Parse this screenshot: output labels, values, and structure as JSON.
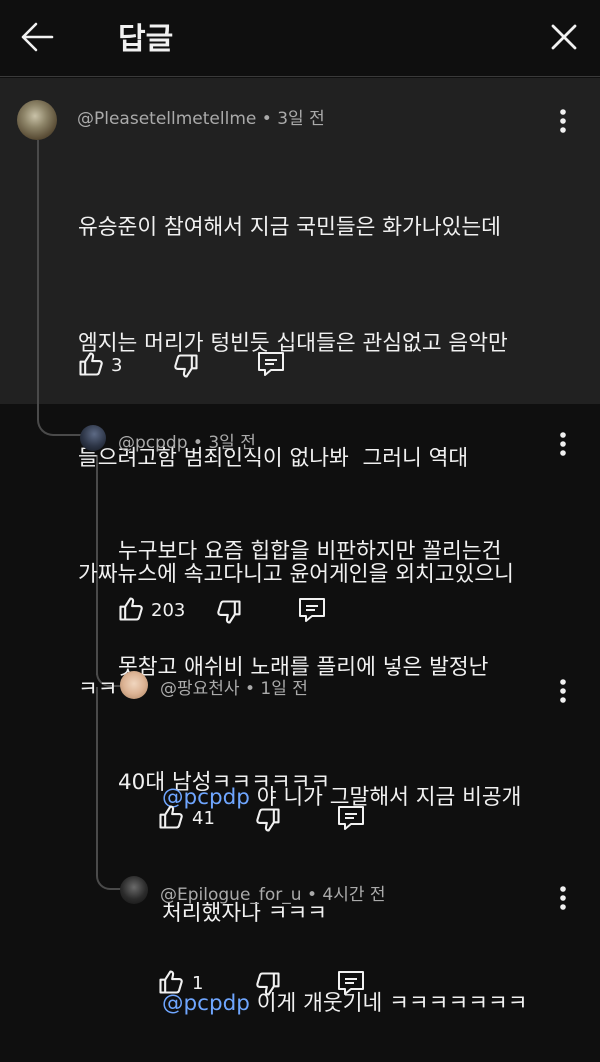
{
  "header": {
    "title": "답글",
    "back_icon": "arrow-left-icon",
    "close_icon": "close-icon"
  },
  "comments": [
    {
      "author": "@Pleasetellmetellme",
      "time": "3일 전",
      "meta_sep": " • ",
      "lines": [
        "유승준이 참여해서 지금 국민들은 화가나있는데",
        "엠지는 머리가 텅빈듯 십대들은 관심없고 음악만",
        "들으려고함 범죄인식이 없나봐  그러니 역대",
        "가짜뉴스에 속고다니고 윤어게인을 외치고있으니",
        "ㅋㅋ"
      ],
      "likes": "3"
    },
    {
      "author": "@pcpdp",
      "time": "3일 전",
      "meta_sep": " • ",
      "lines": [
        "누구보다 요즘 힙합을 비판하지만 꼴리는건",
        "못참고 애쉬비 노래를 플리에 넣은 발정난",
        "40대 남성ㅋㅋㅋㅋㅋㅋ"
      ],
      "likes": "203"
    },
    {
      "author": "@팡요천사",
      "time": "1일 전",
      "meta_sep": " • ",
      "mention": "@pcpdp",
      "line1_rest": " 야 니가 그말해서 지금 비공개",
      "line2": "처리했자나 ㅋㅋㅋ",
      "likes": "41"
    },
    {
      "author": "@Epilogue_for_u",
      "time": "4시간 전",
      "meta_sep": " • ",
      "mention": "@pcpdp",
      "line1_rest": " 이게 개웃기네 ㅋㅋㅋㅋㅋㅋㅋ",
      "likes": "1"
    }
  ],
  "colors": {
    "background": "#0f0f0f",
    "highlight": "#212121",
    "mention": "#6fa6ff",
    "secondary_text": "#aaaaaa"
  }
}
